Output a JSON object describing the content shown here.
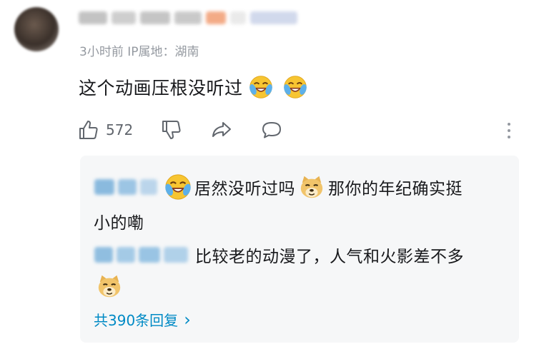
{
  "comment": {
    "meta": "3小时前 IP属地：湖南",
    "text": "这个动画压根没听过",
    "like_count": "572"
  },
  "replies": [
    {
      "text_before": "居然没听过吗",
      "text_after": "那你的年纪确实挺",
      "text_wrap": "小的嘞"
    },
    {
      "text": "比较老的动漫了，人气和火影差不多"
    }
  ],
  "view_all": {
    "label": "共390条回复",
    "chevron": "›"
  },
  "icons": {
    "like": "thumbs-up-icon",
    "dislike": "thumbs-down-icon",
    "share": "share-icon",
    "reply": "comment-icon",
    "more": "more-vertical-icon",
    "emoji_laugh": "laughing-crying-emoji",
    "emoji_doge": "doge-emoji"
  },
  "colors": {
    "link": "#008ac5",
    "meta": "#9499a0",
    "reply_bg": "#f6f7f8"
  }
}
